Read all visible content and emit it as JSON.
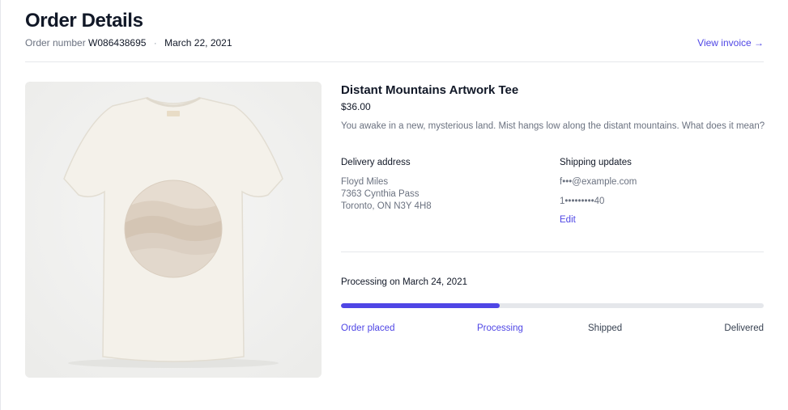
{
  "header": {
    "title": "Order Details",
    "order_label": "Order number",
    "order_number": "W086438695",
    "separator": "·",
    "order_date": "March 22, 2021",
    "invoice_link": "View invoice →"
  },
  "product": {
    "name": "Distant Mountains Artwork Tee",
    "price": "$36.00",
    "description": "You awake in a new, mysterious land. Mist hangs low along the distant mountains. What does it mean?",
    "image_icon": "tshirt-icon"
  },
  "delivery": {
    "title": "Delivery address",
    "name": "Floyd Miles",
    "street": "7363 Cynthia Pass",
    "city": "Toronto, ON N3Y 4H8"
  },
  "shipping": {
    "title": "Shipping updates",
    "email": "f•••@example.com",
    "phone": "1•••••••••40",
    "edit_label": "Edit"
  },
  "progress": {
    "status_text": "Processing on March 24, 2021",
    "fraction": 0.375,
    "steps": [
      {
        "label": "Order placed",
        "state": "active"
      },
      {
        "label": "Processing",
        "state": "active"
      },
      {
        "label": "Shipped",
        "state": "inactive"
      },
      {
        "label": "Delivered",
        "state": "inactive"
      }
    ]
  },
  "colors": {
    "accent": "#4f46e5",
    "track": "#e5e7eb",
    "muted_text": "#6b7280"
  }
}
